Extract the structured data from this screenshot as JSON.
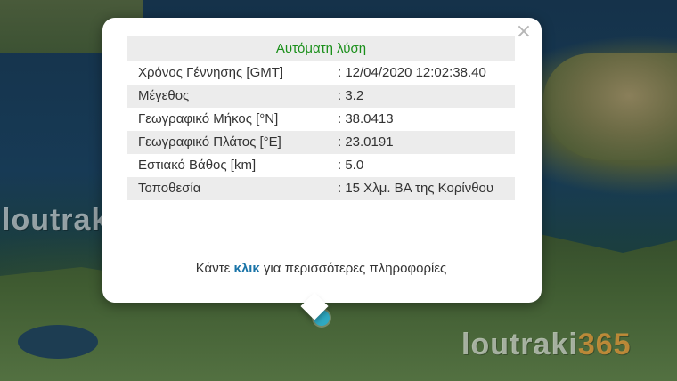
{
  "watermark": {
    "brand": "loutraki",
    "number": "365"
  },
  "popup": {
    "title": "Αυτόματη λύση",
    "rows": [
      {
        "label": "Χρόνος Γέννησης [GMT]",
        "value": ": 12/04/2020 12:02:38.40"
      },
      {
        "label": "Μέγεθος",
        "value": ": 3.2"
      },
      {
        "label": "Γεωγραφικό Μήκος [°N]",
        "value": ": 38.0413"
      },
      {
        "label": "Γεωγραφικό Πλάτος [°E]",
        "value": ": 23.0191"
      },
      {
        "label": "Εστιακό Βάθος [km]",
        "value": ": 5.0"
      },
      {
        "label": "Τοποθεσία",
        "value": ": 15 Χλμ. ΒΑ της Κορίνθου"
      }
    ],
    "more_prefix": "Κάντε ",
    "more_link": "κλικ",
    "more_suffix": " για περισσότερες πληροφορίες",
    "close_glyph": "×"
  },
  "colors": {
    "title": "#1a8f1a",
    "link": "#1a74a8",
    "marker": "#2fa9c2"
  }
}
